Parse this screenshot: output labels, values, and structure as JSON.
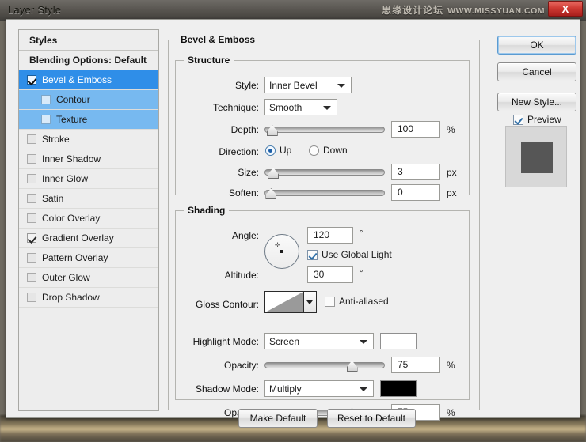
{
  "window": {
    "title": "Layer Style",
    "close_label": "X",
    "watermark_cn": "思缘设计论坛",
    "watermark_url": "WWW.MISSYUAN.COM"
  },
  "styles_panel": {
    "header": "Styles",
    "items": [
      {
        "label": "Blending Options: Default",
        "checkbox": false,
        "has_checkbox": false,
        "state": "normal",
        "indent": false
      },
      {
        "label": "Bevel & Emboss",
        "checkbox": true,
        "has_checkbox": true,
        "state": "selected",
        "indent": false
      },
      {
        "label": "Contour",
        "checkbox": false,
        "has_checkbox": true,
        "state": "selected-child",
        "indent": true
      },
      {
        "label": "Texture",
        "checkbox": false,
        "has_checkbox": true,
        "state": "selected-child",
        "indent": true
      },
      {
        "label": "Stroke",
        "checkbox": false,
        "has_checkbox": true,
        "state": "normal",
        "indent": false
      },
      {
        "label": "Inner Shadow",
        "checkbox": false,
        "has_checkbox": true,
        "state": "normal",
        "indent": false
      },
      {
        "label": "Inner Glow",
        "checkbox": false,
        "has_checkbox": true,
        "state": "normal",
        "indent": false
      },
      {
        "label": "Satin",
        "checkbox": false,
        "has_checkbox": true,
        "state": "normal",
        "indent": false
      },
      {
        "label": "Color Overlay",
        "checkbox": false,
        "has_checkbox": true,
        "state": "normal",
        "indent": false
      },
      {
        "label": "Gradient Overlay",
        "checkbox": true,
        "has_checkbox": true,
        "state": "normal",
        "indent": false
      },
      {
        "label": "Pattern Overlay",
        "checkbox": false,
        "has_checkbox": true,
        "state": "normal",
        "indent": false
      },
      {
        "label": "Outer Glow",
        "checkbox": false,
        "has_checkbox": true,
        "state": "normal",
        "indent": false
      },
      {
        "label": "Drop Shadow",
        "checkbox": false,
        "has_checkbox": true,
        "state": "normal",
        "indent": false
      }
    ]
  },
  "main": {
    "group_title": "Bevel & Emboss",
    "structure": {
      "title": "Structure",
      "style_label": "Style:",
      "style_value": "Inner Bevel",
      "technique_label": "Technique:",
      "technique_value": "Smooth",
      "depth_label": "Depth:",
      "depth_value": "100",
      "depth_unit": "%",
      "depth_percent": 2,
      "direction_label": "Direction:",
      "direction_up": "Up",
      "direction_down": "Down",
      "direction_selected": "Up",
      "size_label": "Size:",
      "size_value": "3",
      "size_unit": "px",
      "size_percent": 3,
      "soften_label": "Soften:",
      "soften_value": "0",
      "soften_unit": "px",
      "soften_percent": 1
    },
    "shading": {
      "title": "Shading",
      "angle_label": "Angle:",
      "angle_value": "120",
      "angle_unit": "°",
      "use_global_light_label": "Use Global Light",
      "use_global_light": true,
      "altitude_label": "Altitude:",
      "altitude_value": "30",
      "altitude_unit": "°",
      "gloss_contour_label": "Gloss Contour:",
      "anti_aliased_label": "Anti-aliased",
      "anti_aliased": false,
      "highlight_mode_label": "Highlight Mode:",
      "highlight_mode_value": "Screen",
      "highlight_color": "#ffffff",
      "highlight_opacity_label": "Opacity:",
      "highlight_opacity_value": "75",
      "highlight_opacity_unit": "%",
      "highlight_opacity_percent": 75,
      "shadow_mode_label": "Shadow Mode:",
      "shadow_mode_value": "Multiply",
      "shadow_color": "#000000",
      "shadow_opacity_label": "Opacity:",
      "shadow_opacity_value": "75",
      "shadow_opacity_unit": "%",
      "shadow_opacity_percent": 75
    },
    "make_default_label": "Make Default",
    "reset_default_label": "Reset to Default"
  },
  "right": {
    "ok_label": "OK",
    "cancel_label": "Cancel",
    "new_style_label": "New Style...",
    "preview_label": "Preview",
    "preview_checked": true,
    "preview_color": "#565656"
  }
}
